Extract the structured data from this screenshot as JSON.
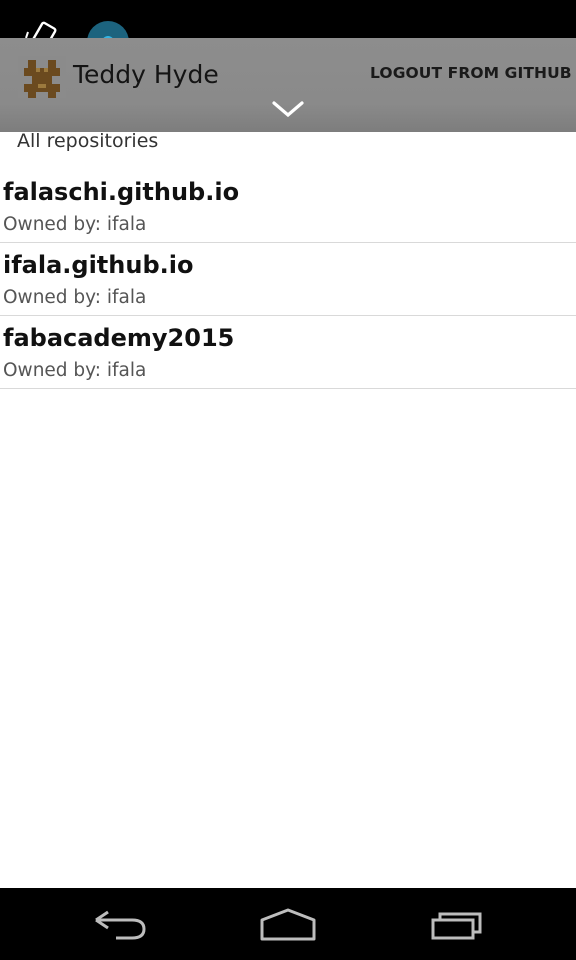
{
  "status_bar": {
    "icons": [
      "screen-rotation-icon",
      "notification-dot-icon"
    ]
  },
  "action_bar": {
    "app_icon": "teddy-hyde-app-icon",
    "title": "Teddy Hyde",
    "logout_label": "LOGOUT FROM GITHUB",
    "expand_icon": "chevron-down-icon"
  },
  "section": {
    "header": "All repositories"
  },
  "repositories": [
    {
      "name": "falaschi.github.io",
      "owner": "Owned by: ifala"
    },
    {
      "name": "ifala.github.io",
      "owner": "Owned by: ifala"
    },
    {
      "name": "fabacademy2015",
      "owner": "Owned by: ifala"
    }
  ],
  "nav_bar": {
    "icons": [
      "back-icon",
      "home-icon",
      "recent-apps-icon"
    ]
  },
  "colors": {
    "action_bar": "#8a8a8a",
    "accent_dot": "#33b5e5",
    "divider": "#d9d9d9"
  }
}
